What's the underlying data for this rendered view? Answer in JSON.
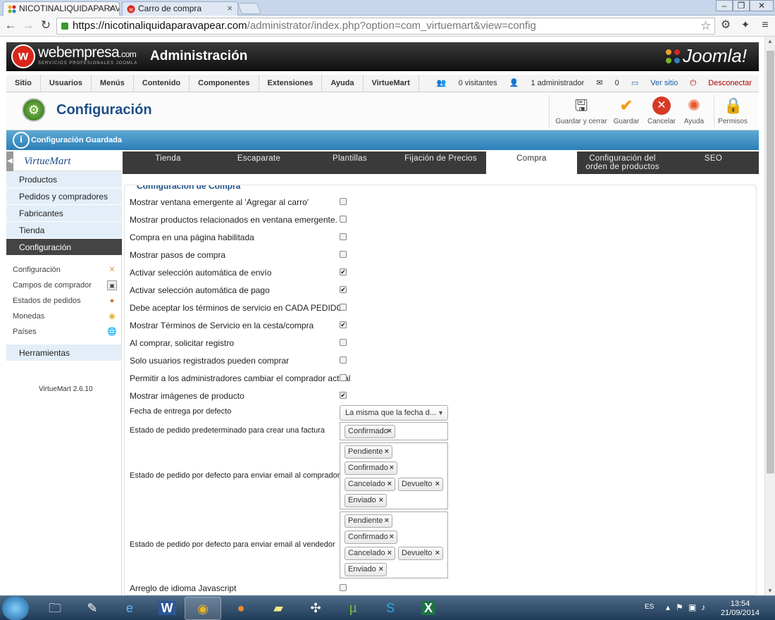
{
  "browser": {
    "tabs": [
      {
        "label": "NICOTINALIQUIDAPARAV",
        "close": "×",
        "active": true
      },
      {
        "label": "Carro de compra",
        "close": "×",
        "active": false
      }
    ],
    "window_controls": [
      "–",
      "❐",
      "✕"
    ],
    "url_host": "https://nicotinaliquidaparavapear.com",
    "url_path": "/administrator/index.php?option=com_virtuemart&view=config"
  },
  "header": {
    "brand_main": "webempresa",
    "brand_suffix": ".com",
    "brand_sub": "SERVICIOS PROFESIONALES JOOMLA",
    "admin_title": "Administración",
    "joomla_logo": "Joomla!"
  },
  "menu": {
    "items": [
      "Sitio",
      "Usuarios",
      "Menús",
      "Contenido",
      "Componentes",
      "Extensiones",
      "Ayuda",
      "VirtueMart"
    ],
    "status": {
      "visitors": "0 visitantes",
      "admins": "1 administrador",
      "messages": "0",
      "view_site": "Ver sitio",
      "logout": "Desconectar"
    }
  },
  "toolbar": {
    "title": "Configuración",
    "buttons": [
      "Guardar y cerrar",
      "Guardar",
      "Cancelar",
      "Ayuda",
      "Permisos"
    ]
  },
  "message": "Configuración Guardada",
  "sidebar": {
    "logo": "VirtueMart",
    "nav": [
      "Productos",
      "Pedidos y compradores",
      "Fabricantes",
      "Tienda",
      "Configuración"
    ],
    "sub": [
      "Configuración",
      "Campos de comprador",
      "Estados de pedidos",
      "Monedas",
      "Países"
    ],
    "tools": "Herramientas",
    "version": "VirtueMart 2.6.10"
  },
  "tabs": [
    "Tienda",
    "Escaparate",
    "Plantillas",
    "Fijación de Precios",
    "Compra",
    "Configuración del orden de productos",
    "SEO"
  ],
  "tab_line1": "Configuración del",
  "tab_line2": "orden de productos",
  "section": {
    "title": "Configuración de Compra",
    "options": [
      {
        "label": "Mostrar ventana emergente al 'Agregar al carro'",
        "checked": false
      },
      {
        "label": "Mostrar productos relacionados en ventana emergente.",
        "checked": false
      },
      {
        "label": "Compra en una página habilitada",
        "checked": false
      },
      {
        "label": "Mostrar pasos de compra",
        "checked": false
      },
      {
        "label": "Activar selección automática de envío",
        "checked": true
      },
      {
        "label": "Activar selección automática de pago",
        "checked": true
      },
      {
        "label": "Debe aceptar los términos de servicio en CADA PEDIDO",
        "checked": false
      },
      {
        "label": "Mostrar Términos de Servicio en la cesta/compra",
        "checked": true
      },
      {
        "label": "Al comprar, solicitar registro",
        "checked": false
      },
      {
        "label": "Solo usuarios registrados pueden comprar",
        "checked": false
      },
      {
        "label": "Permitir a los administradores cambiar el comprador actual",
        "checked": false
      },
      {
        "label": "Mostrar imágenes de producto",
        "checked": true
      }
    ],
    "delivery_label": "Fecha de entrega por defecto",
    "delivery_value": "La misma que la fecha d...",
    "invoice_label": "Estado de pedido predeterminado para crear una factura",
    "invoice_tags": [
      "Confirmado"
    ],
    "email_buyer_label": "Estado de pedido por defecto para enviar email al comprador",
    "email_buyer_tags": [
      "Pendiente",
      "Confirmado",
      "Cancelado",
      "Devuelto",
      "Enviado"
    ],
    "email_vendor_label": "Estado de pedido por defecto para enviar email al vendedor",
    "email_vendor_tags": [
      "Pendiente",
      "Confirmado",
      "Cancelado",
      "Devuelto",
      "Enviado"
    ],
    "js_label": "Arreglo de idioma Javascript",
    "js_checked": false
  },
  "taskbar": {
    "lang": "ES",
    "time": "13:54",
    "date": "21/09/2014"
  }
}
